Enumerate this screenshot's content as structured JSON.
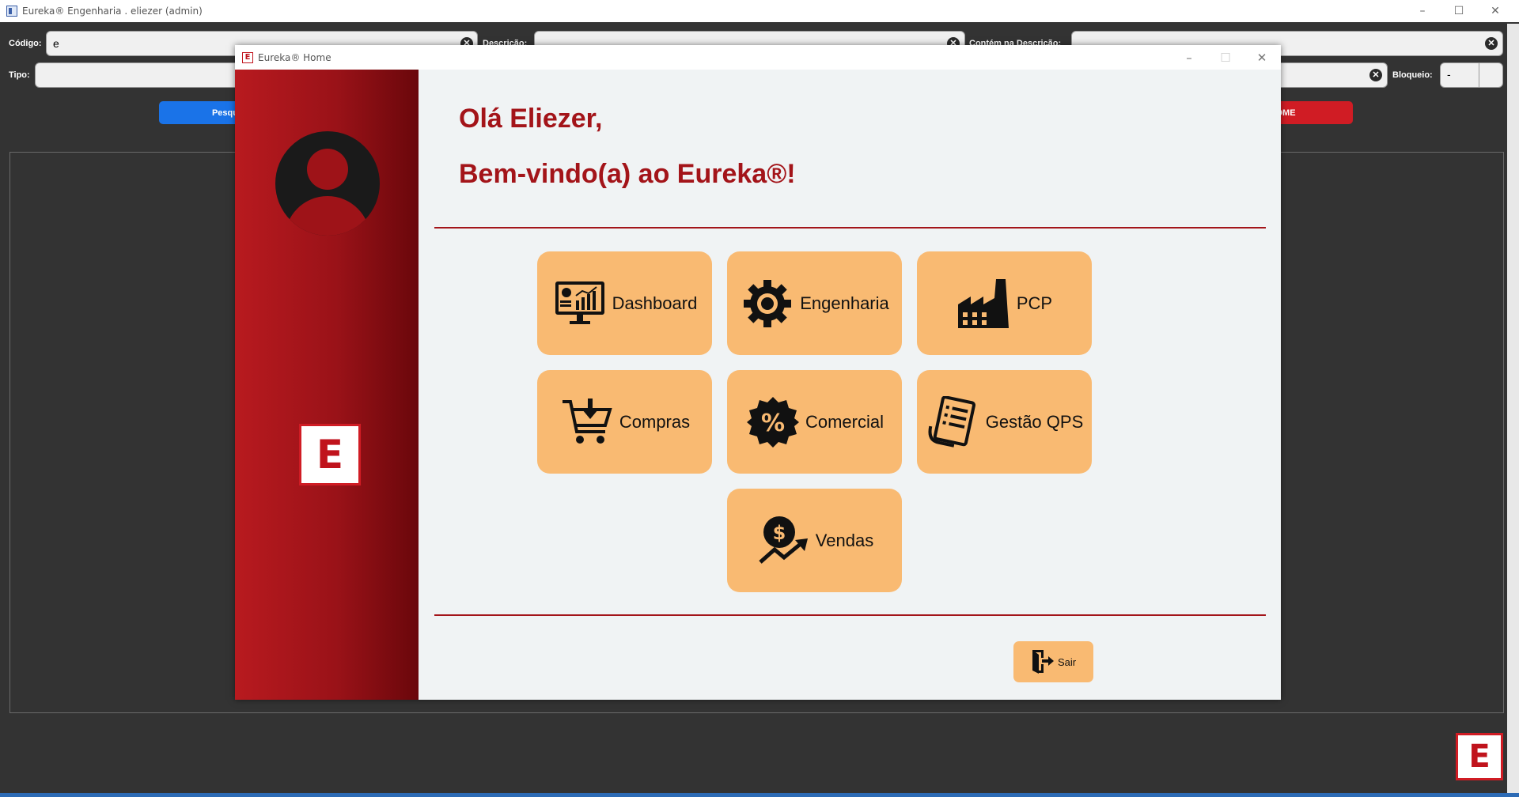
{
  "main_window": {
    "title": "Eureka® Engenharia . eliezer (admin)",
    "controls": {
      "minimize": "–",
      "maximize": "☐",
      "close": "✕"
    },
    "filters": {
      "codigo": {
        "label": "Código:",
        "value": "e"
      },
      "descricao": {
        "label": "Descrição:",
        "value": ""
      },
      "contem": {
        "label": "Contém na Descrição:",
        "value": ""
      },
      "tipo": {
        "label": "Tipo:",
        "value": ""
      },
      "bloqueio": {
        "label": "Bloqueio:",
        "value": "-"
      }
    },
    "buttons": {
      "search_label": "Pesqui",
      "home_label": "OME"
    },
    "logo_letter": "E"
  },
  "home_dialog": {
    "title": "Eureka® Home",
    "title_icon_letter": "E",
    "controls": {
      "minimize": "–",
      "maximize": "☐",
      "close": "✕"
    },
    "greeting_line1": "Olá Eliezer,",
    "greeting_line2": "Bem-vindo(a) ao Eureka®!",
    "sidebar_logo_letter": "E",
    "modules": [
      {
        "label": "Dashboard",
        "icon": "dashboard-monitor-icon"
      },
      {
        "label": "Engenharia",
        "icon": "gear-icon"
      },
      {
        "label": "PCP",
        "icon": "factory-icon"
      },
      {
        "label": "Compras",
        "icon": "cart-download-icon"
      },
      {
        "label": "Comercial",
        "icon": "percent-badge-icon"
      },
      {
        "label": "Gestão QPS",
        "icon": "document-list-icon"
      },
      {
        "label": "Vendas",
        "icon": "money-growth-icon"
      }
    ],
    "exit_label": "Sair",
    "colors": {
      "accent": "#a31419",
      "tile": "#f9ba72",
      "sidebar": "#9a1218",
      "background": "#f0f3f4"
    }
  }
}
